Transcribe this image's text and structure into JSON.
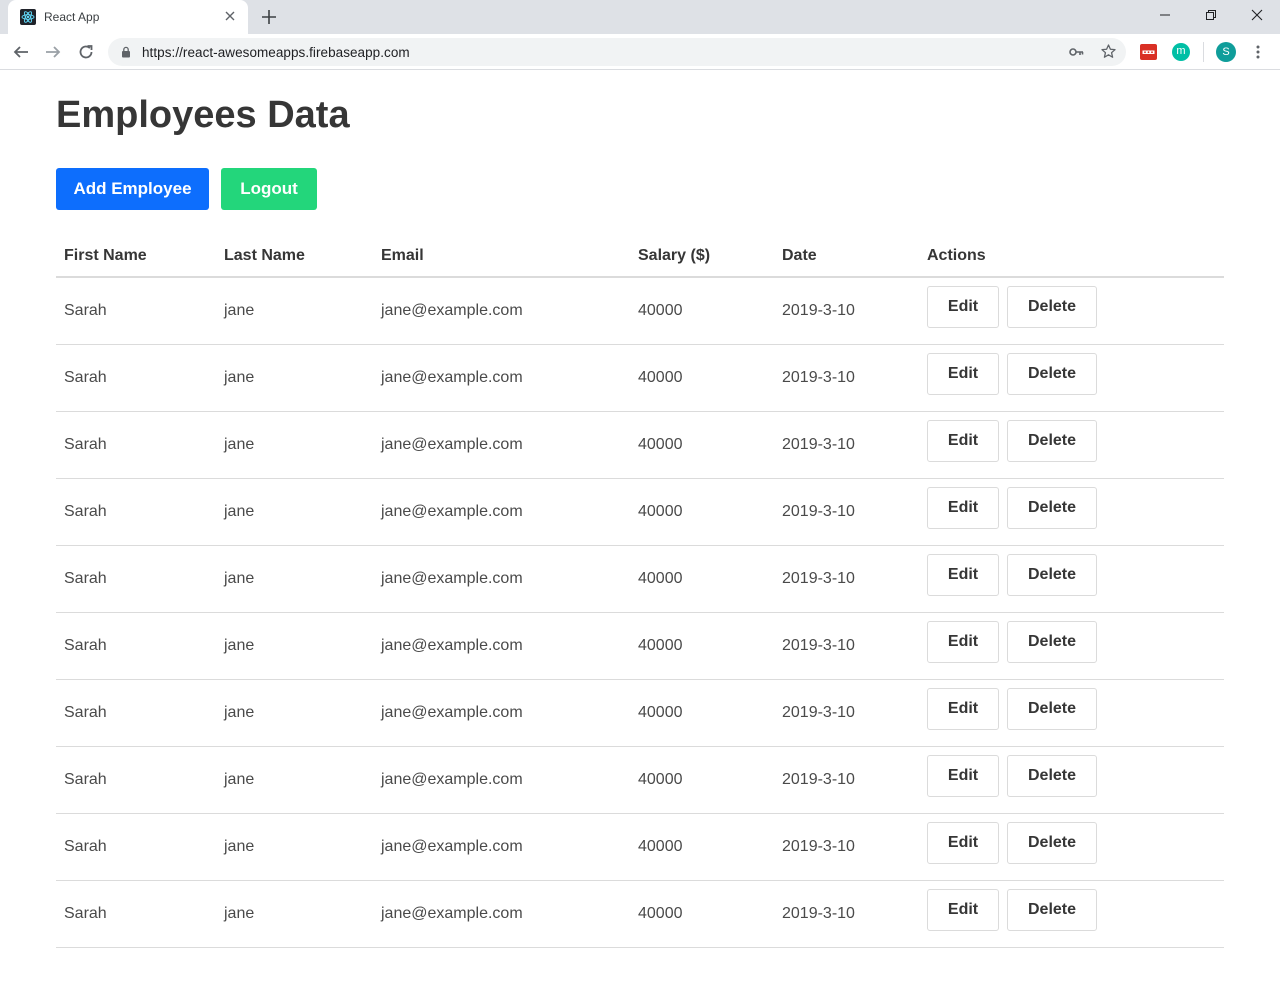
{
  "browser": {
    "tab_title": "React App",
    "url": "https://react-awesomeapps.firebaseapp.com",
    "extension_label": "m",
    "profile_initial": "S"
  },
  "page": {
    "title": "Employees Data",
    "add_button": "Add Employee",
    "logout_button": "Logout"
  },
  "table": {
    "headers": [
      "First Name",
      "Last Name",
      "Email",
      "Salary ($)",
      "Date",
      "Actions"
    ],
    "edit_label": "Edit",
    "delete_label": "Delete",
    "rows": [
      {
        "first": "Sarah",
        "last": "jane",
        "email": "jane@example.com",
        "salary": "40000",
        "date": "2019-3-10"
      },
      {
        "first": "Sarah",
        "last": "jane",
        "email": "jane@example.com",
        "salary": "40000",
        "date": "2019-3-10"
      },
      {
        "first": "Sarah",
        "last": "jane",
        "email": "jane@example.com",
        "salary": "40000",
        "date": "2019-3-10"
      },
      {
        "first": "Sarah",
        "last": "jane",
        "email": "jane@example.com",
        "salary": "40000",
        "date": "2019-3-10"
      },
      {
        "first": "Sarah",
        "last": "jane",
        "email": "jane@example.com",
        "salary": "40000",
        "date": "2019-3-10"
      },
      {
        "first": "Sarah",
        "last": "jane",
        "email": "jane@example.com",
        "salary": "40000",
        "date": "2019-3-10"
      },
      {
        "first": "Sarah",
        "last": "jane",
        "email": "jane@example.com",
        "salary": "40000",
        "date": "2019-3-10"
      },
      {
        "first": "Sarah",
        "last": "jane",
        "email": "jane@example.com",
        "salary": "40000",
        "date": "2019-3-10"
      },
      {
        "first": "Sarah",
        "last": "jane",
        "email": "jane@example.com",
        "salary": "40000",
        "date": "2019-3-10"
      },
      {
        "first": "Sarah",
        "last": "jane",
        "email": "jane@example.com",
        "salary": "40000",
        "date": "2019-3-10"
      }
    ]
  },
  "colors": {
    "primary": "#0d6efd",
    "success": "#23d67b",
    "text": "#363636"
  }
}
